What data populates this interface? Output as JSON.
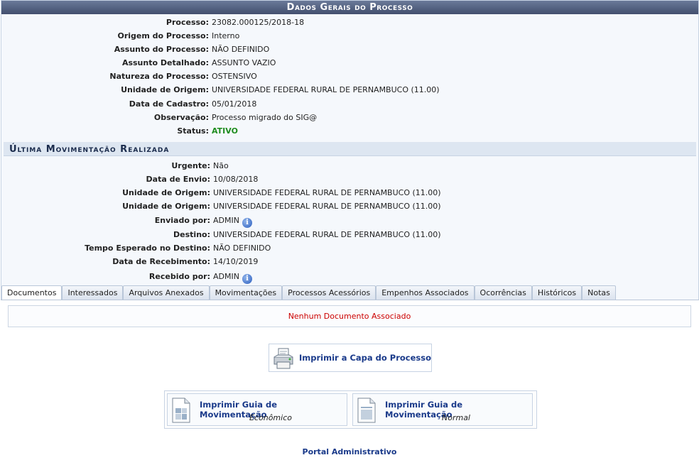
{
  "panel": {
    "title": "Dados Gerais do Processo",
    "general": [
      {
        "label": "Processo:",
        "value": "23082.000125/2018-18"
      },
      {
        "label": "Origem do Processo:",
        "value": "Interno"
      },
      {
        "label": "Assunto do Processo:",
        "value": "NÃO DEFINIDO"
      },
      {
        "label": "Assunto Detalhado:",
        "value": "ASSUNTO VAZIO"
      },
      {
        "label": "Natureza do Processo:",
        "value": "OSTENSIVO"
      },
      {
        "label": "Unidade de Origem:",
        "value": "UNIVERSIDADE FEDERAL RURAL DE PERNAMBUCO (11.00)"
      },
      {
        "label": "Data de Cadastro:",
        "value": "05/01/2018"
      },
      {
        "label": "Observação:",
        "value": "Processo migrado do SIG@"
      },
      {
        "label": "Status:",
        "value": "ATIVO"
      }
    ],
    "last_move_title": "Última Movimentação Realizada",
    "last_move": [
      {
        "label": "Urgente:",
        "value": "Não"
      },
      {
        "label": "Data de Envio:",
        "value": "10/08/2018"
      },
      {
        "label": "Unidade de Origem:",
        "value": "UNIVERSIDADE FEDERAL RURAL DE PERNAMBUCO (11.00)"
      },
      {
        "label": "Unidade de Origem:",
        "value": "UNIVERSIDADE FEDERAL RURAL DE PERNAMBUCO (11.00)"
      },
      {
        "label": "Enviado por:",
        "value": "ADMIN"
      },
      {
        "label": "Destino:",
        "value": "UNIVERSIDADE FEDERAL RURAL DE PERNAMBUCO (11.00)"
      },
      {
        "label": "Tempo Esperado no Destino:",
        "value": "NÃO DEFINIDO"
      },
      {
        "label": "Data de Recebimento:",
        "value": "14/10/2019"
      },
      {
        "label": "Recebido por:",
        "value": "ADMIN"
      }
    ],
    "info_icon_glyph": "i"
  },
  "tabs": [
    {
      "label": "Documentos",
      "active": true
    },
    {
      "label": "Interessados"
    },
    {
      "label": "Arquivos Anexados"
    },
    {
      "label": "Movimentações"
    },
    {
      "label": "Processos Acessórios"
    },
    {
      "label": "Empenhos Associados"
    },
    {
      "label": "Ocorrências"
    },
    {
      "label": "Históricos"
    },
    {
      "label": "Notas"
    }
  ],
  "tab_content": {
    "empty_message": "Nenhum Documento Associado"
  },
  "actions": {
    "print_cover": "Imprimir a Capa do Processo",
    "guide_economic_title": "Imprimir Guia de Movimentação",
    "guide_economic_sub": "Econômico",
    "guide_normal_title": "Imprimir Guia de Movimentação",
    "guide_normal_sub": "Normal"
  },
  "footer": {
    "portal_link": "Portal Administrativo"
  },
  "colors": {
    "status_active": "#1e8c1e",
    "empty_message": "#cc0000",
    "link": "#1a3a8a"
  }
}
